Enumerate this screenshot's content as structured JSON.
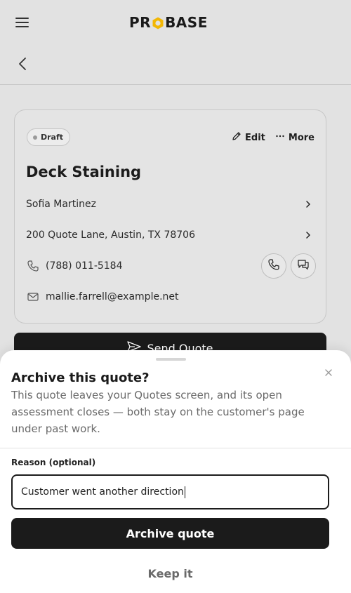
{
  "header": {
    "logo_text": "PROBASE",
    "menu_icon": "hamburger-icon",
    "back_icon": "chevron-left-icon"
  },
  "card": {
    "status_badge": "Draft",
    "edit_label": "Edit",
    "more_label": "More",
    "title": "Deck Staining",
    "customer_name": "Sofia Martinez",
    "address": "200 Quote Lane, Austin, TX 78706",
    "phone": "(788) 011-5184",
    "email": "mallie.farrell@example.net"
  },
  "send_button_label": "Send Quote",
  "sheet": {
    "title": "Archive this quote?",
    "description": "This quote leaves your Quotes screen, and its open assessment closes — both stay on the customer's page under past work.",
    "reason_label": "Reason (optional)",
    "reason_value": "Customer went another direction",
    "archive_label": "Archive quote",
    "keep_label": "Keep it"
  },
  "colors": {
    "background": "#e2e2e2",
    "primary": "#1b1b1b",
    "brand_accent": "#f2b705",
    "muted_text": "#6a6a6a"
  }
}
